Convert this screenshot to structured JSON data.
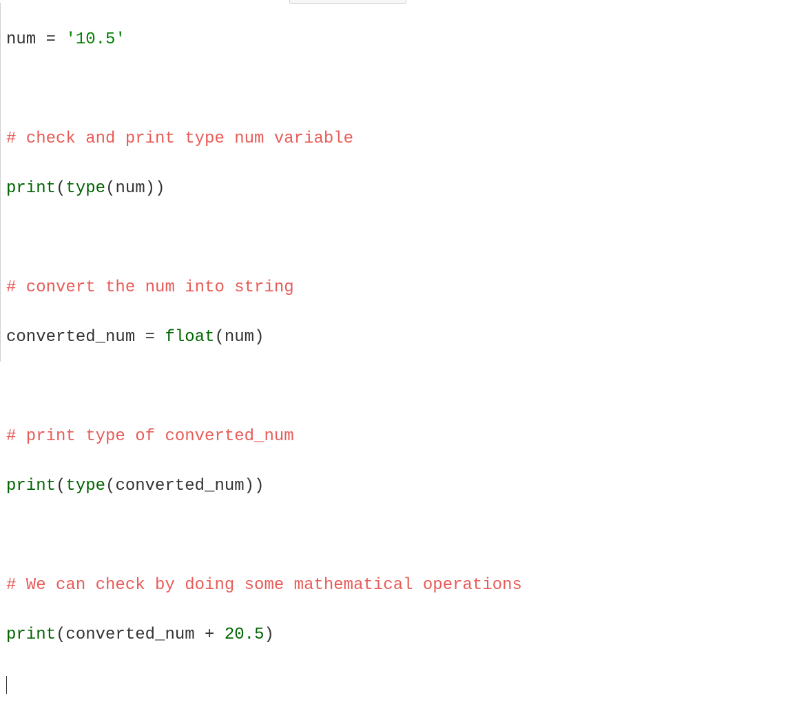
{
  "code": {
    "l1": {
      "id1": "num",
      "op": " = ",
      "str": "'10.5'"
    },
    "l2": "",
    "l3": {
      "comment": "# check and print type num variable"
    },
    "l4": {
      "b1": "print",
      "p1": "(",
      "b2": "type",
      "p2": "(",
      "id": "num",
      "p3": ")",
      "p4": ")"
    },
    "l5": "",
    "l6": {
      "comment": "# convert the num into string"
    },
    "l7": {
      "id1": "converted_num",
      "op": " = ",
      "b1": "float",
      "p1": "(",
      "id2": "num",
      "p2": ")"
    },
    "l8": "",
    "l9": {
      "comment": "# print type of converted_num"
    },
    "l10": {
      "b1": "print",
      "p1": "(",
      "b2": "type",
      "p2": "(",
      "id": "converted_num",
      "p3": ")",
      "p4": ")"
    },
    "l11": "",
    "l12": {
      "comment": "# We can check by doing some mathematical operations"
    },
    "l13": {
      "b1": "print",
      "p1": "(",
      "id": "converted_num",
      "op": " + ",
      "num": "20.5",
      "p2": ")"
    }
  }
}
